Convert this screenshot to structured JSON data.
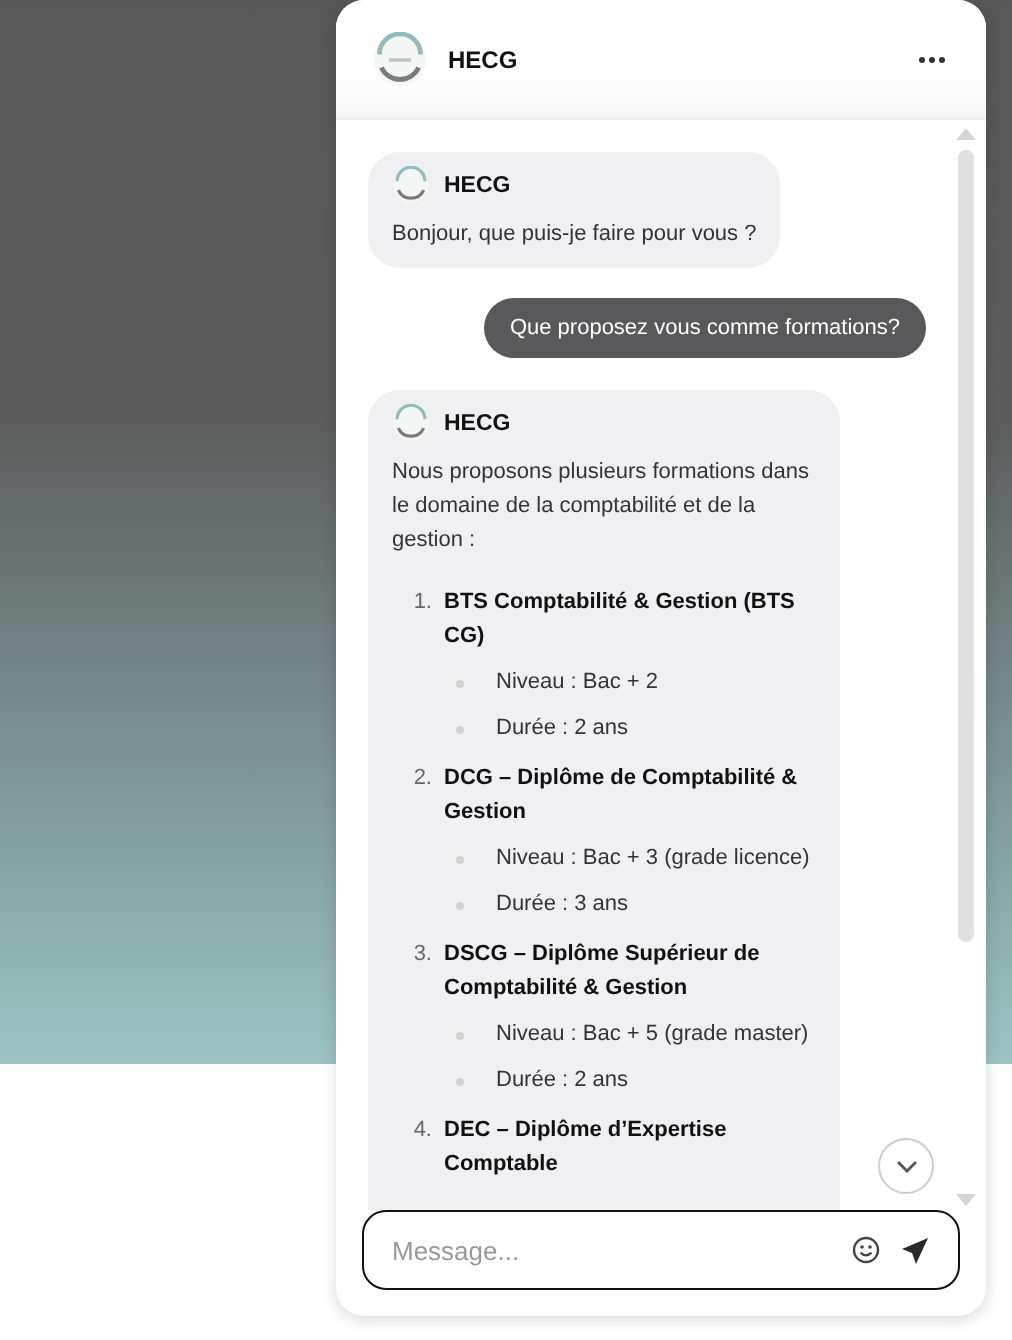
{
  "header": {
    "title": "HECG"
  },
  "messages": [
    {
      "kind": "bot",
      "sender": "HECG",
      "text": "Bonjour, que puis-je faire pour vous ?"
    },
    {
      "kind": "user",
      "text": "Que proposez vous comme formations?"
    },
    {
      "kind": "bot",
      "sender": "HECG",
      "text": "Nous proposons plusieurs formations dans le domaine de la comptabilité et de la gestion :",
      "items": [
        {
          "number": "1.",
          "title": "BTS Comptabilité & Gestion (BTS CG)",
          "details": [
            "Niveau : Bac + 2",
            "Durée : 2 ans"
          ]
        },
        {
          "number": "2.",
          "title": "DCG – Diplôme de Comptabilité & Gestion",
          "details": [
            "Niveau : Bac + 3 (grade licence)",
            "Durée : 3 ans"
          ]
        },
        {
          "number": "3.",
          "title": "DSCG – Diplôme Supérieur de Comptabilité & Gestion",
          "details": [
            "Niveau : Bac + 5 (grade master)",
            "Durée : 2 ans"
          ]
        },
        {
          "number": "4.",
          "title": "DEC – Diplôme d’Expertise Comptable"
        }
      ]
    }
  ],
  "composer": {
    "placeholder": "Message..."
  }
}
